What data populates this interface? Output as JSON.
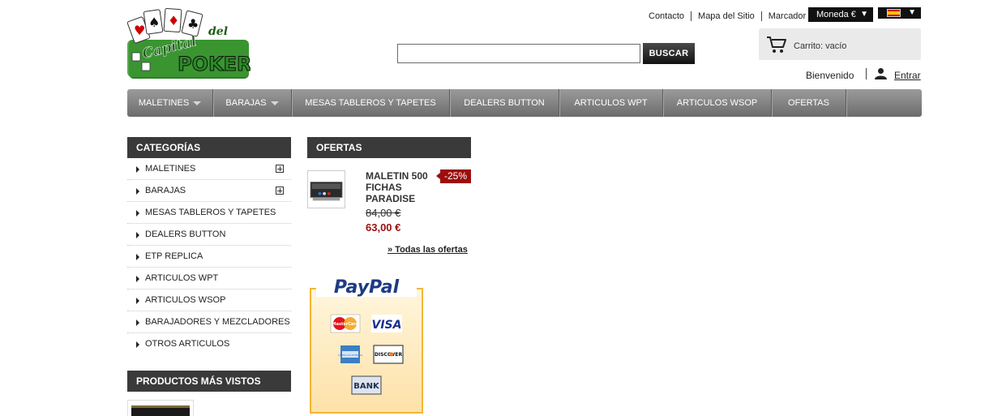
{
  "header": {
    "logo_text_1": "Capital",
    "logo_text_2": "del",
    "logo_text_3": "POKER",
    "search_button": "BUSCAR",
    "search_value": "",
    "top_links": [
      "Contacto",
      "Mapa del Sitio",
      "Marcador"
    ],
    "currency_label": "Moneda €",
    "cart_label": "Carrito: vacío",
    "welcome": "Bienvenido",
    "login": "Entrar"
  },
  "nav": {
    "items": [
      {
        "label": "Maletines",
        "dropdown": true
      },
      {
        "label": "Barajas",
        "dropdown": true
      },
      {
        "label": "Mesas tableros y tapetes",
        "dropdown": false
      },
      {
        "label": "Dealers button",
        "dropdown": false
      },
      {
        "label": "Articulos WPT",
        "dropdown": false
      },
      {
        "label": "Articulos WSOP",
        "dropdown": false
      },
      {
        "label": "Ofertas",
        "dropdown": false
      }
    ]
  },
  "categories": {
    "title": "Categorías",
    "items": [
      {
        "label": "Maletines",
        "expandable": true
      },
      {
        "label": "Barajas",
        "expandable": true
      },
      {
        "label": "Mesas tableros y tapetes",
        "expandable": false
      },
      {
        "label": "Dealers button",
        "expandable": false
      },
      {
        "label": "ETP replica",
        "expandable": false
      },
      {
        "label": "Articulos WPT",
        "expandable": false
      },
      {
        "label": "Articulos WSOP",
        "expandable": false
      },
      {
        "label": "Barajadores y mezcladores",
        "expandable": false
      },
      {
        "label": "Otros articulos",
        "expandable": false
      }
    ]
  },
  "most_viewed": {
    "title": "Productos más vistos"
  },
  "offers": {
    "title": "Ofertas",
    "product_name": "MALETIN 500 FICHAS PARADISE",
    "discount": "-25%",
    "old_price": "84,00 €",
    "new_price": "63,00 €",
    "all_offers": "» Todas las ofertas"
  },
  "paypal": {
    "brand": "PayPal",
    "cards": [
      "MasterCard",
      "VISA",
      "AMERICAN EXPRESS",
      "DISCOVER",
      "BANK"
    ]
  },
  "colors": {
    "accent_red": "#9b0e0e",
    "block_title_bg": "#3a3a3a",
    "nav_gradient_top": "#9b9b9b",
    "nav_gradient_bottom": "#6c6c6c"
  }
}
